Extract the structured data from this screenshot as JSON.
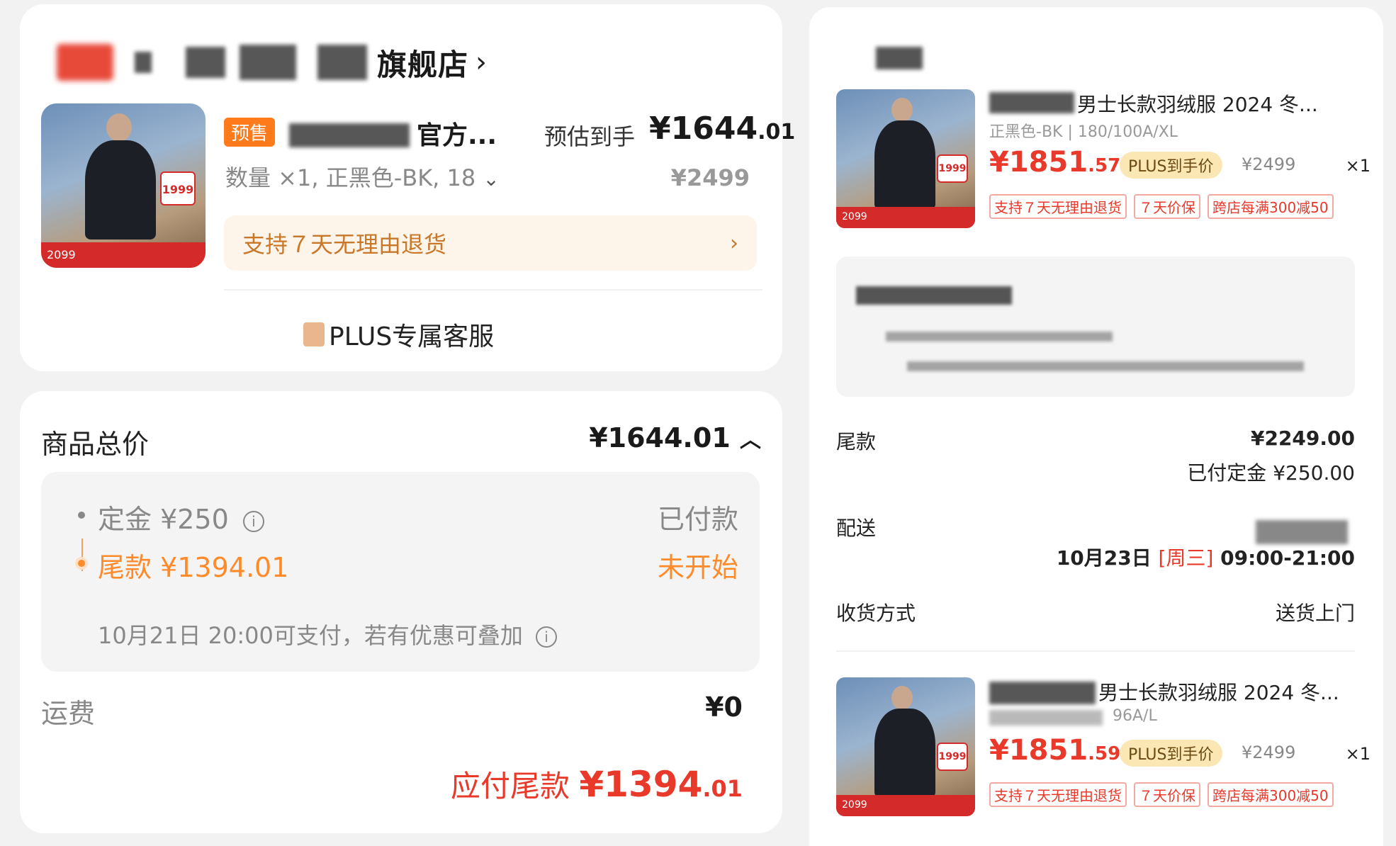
{
  "order": {
    "store_name": "旗舰店",
    "product_title": "官方...",
    "presale_badge": "预售",
    "estimated_label": "预估到手",
    "estimated_price_int": "¥1644",
    "estimated_price_dec": ".01",
    "quantity_spec": "数量 ×1, 正黑色-BK, 18",
    "original_price": "¥2499",
    "return_policy": "支持７天无理由退货",
    "plus_service": "PLUS专属客服"
  },
  "price": {
    "total_label": "商品总价",
    "total_value": "¥1644.01",
    "deposit_label": "定金 ¥250",
    "deposit_status": "已付款",
    "balance_label": "尾款 ¥1394.01",
    "balance_status": "未开始",
    "balance_note": "10月21日 20:00可支付，若有优惠可叠加",
    "shipping_label": "运费",
    "shipping_value": "¥0",
    "due_label": "应付尾款",
    "due_value_int": "¥1394",
    "due_value_dec": ".01"
  },
  "right": {
    "items": [
      {
        "title": "男士长款羽绒服 2024 冬...",
        "spec": "正黑色-BK  |  180/100A/XL",
        "price_int": "¥1851",
        "price_dec": ".57",
        "plus_label": "PLUS到手价",
        "orig_price": "¥2499",
        "qty": "×1",
        "tags": [
          "支持７天无理由退货",
          "７天价保",
          "跨店每满300减50"
        ]
      },
      {
        "title": "男士长款羽绒服 2024 冬...",
        "spec": "96A/L",
        "price_int": "¥1851",
        "price_dec": ".59",
        "plus_label": "PLUS到手价",
        "orig_price": "¥2499",
        "qty": "×1",
        "tags": [
          "支持７天无理由退货",
          "７天价保",
          "跨店每满300减50"
        ]
      }
    ],
    "balance_label": "尾款",
    "balance_value": "¥2249.00",
    "deposit_paid": "已付定金 ¥250.00",
    "delivery_label": "配送",
    "delivery_date": "10月23日",
    "delivery_weekday": "[周三]",
    "delivery_time": "09:00-21:00",
    "receive_label": "收货方式",
    "receive_value": "送货上门"
  },
  "product_image_texts": {
    "price_tag": "1999",
    "promo_price": "2099"
  },
  "colors": {
    "accent_red": "#e8392a",
    "presale_orange": "#ff7a1a",
    "return_orange": "#c9782a",
    "plus_gold": "#fbe7b4"
  }
}
